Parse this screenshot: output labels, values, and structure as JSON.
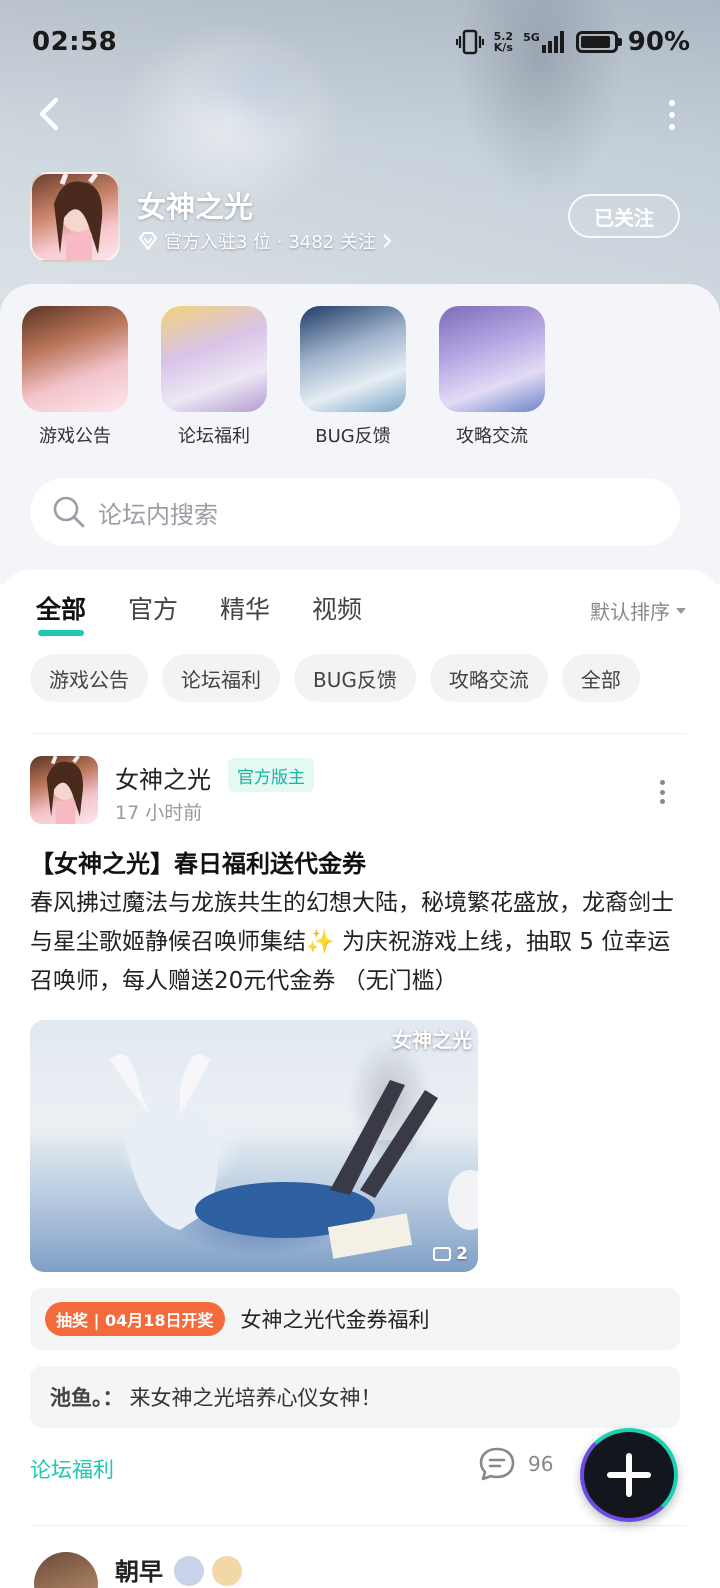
{
  "status_bar": {
    "time": "02:58",
    "net_speed_value": "5.2",
    "net_speed_unit": "K/s",
    "network": "5G",
    "battery_level": 0.9,
    "battery": "90%"
  },
  "header": {
    "forum_name": "女神之光",
    "meta": "官方入驻3 位 · 3482 关注",
    "follow_label": "已关注"
  },
  "categories": [
    {
      "label": "游戏公告"
    },
    {
      "label": "论坛福利"
    },
    {
      "label": "BUG反馈"
    },
    {
      "label": "攻略交流"
    }
  ],
  "search": {
    "placeholder": "论坛内搜索"
  },
  "tabs": [
    {
      "label": "全部"
    },
    {
      "label": "官方"
    },
    {
      "label": "精华"
    },
    {
      "label": "视频"
    }
  ],
  "sort_label": "默认排序",
  "chips": [
    {
      "label": "游戏公告"
    },
    {
      "label": "论坛福利"
    },
    {
      "label": "BUG反馈"
    },
    {
      "label": "攻略交流"
    },
    {
      "label": "全部"
    }
  ],
  "post": {
    "author": "女神之光",
    "badge": "官方版主",
    "time": "17 小时前",
    "title": "【女神之光】春日福利送代金券",
    "body": "春风拂过魔法与龙族共生的幻想大陆，秘境繁花盛放，龙裔剑士与星尘歌姬静候召唤师集结✨ 为庆祝游戏上线，抽取 5 位幸运召唤师，每人赠送20元代金券 （无门槛）",
    "image_watermark": "女神之光",
    "image_count": "2",
    "lottery_tag": "抽奖 | 04月18日开奖",
    "lottery_text": "女神之光代金券福利",
    "comment_author": "池鱼。：",
    "comment_text": "来女神之光培养心仪女神！",
    "forum_tag": "论坛福利",
    "comment_count": "96"
  },
  "next_post": {
    "author": "朝早"
  }
}
